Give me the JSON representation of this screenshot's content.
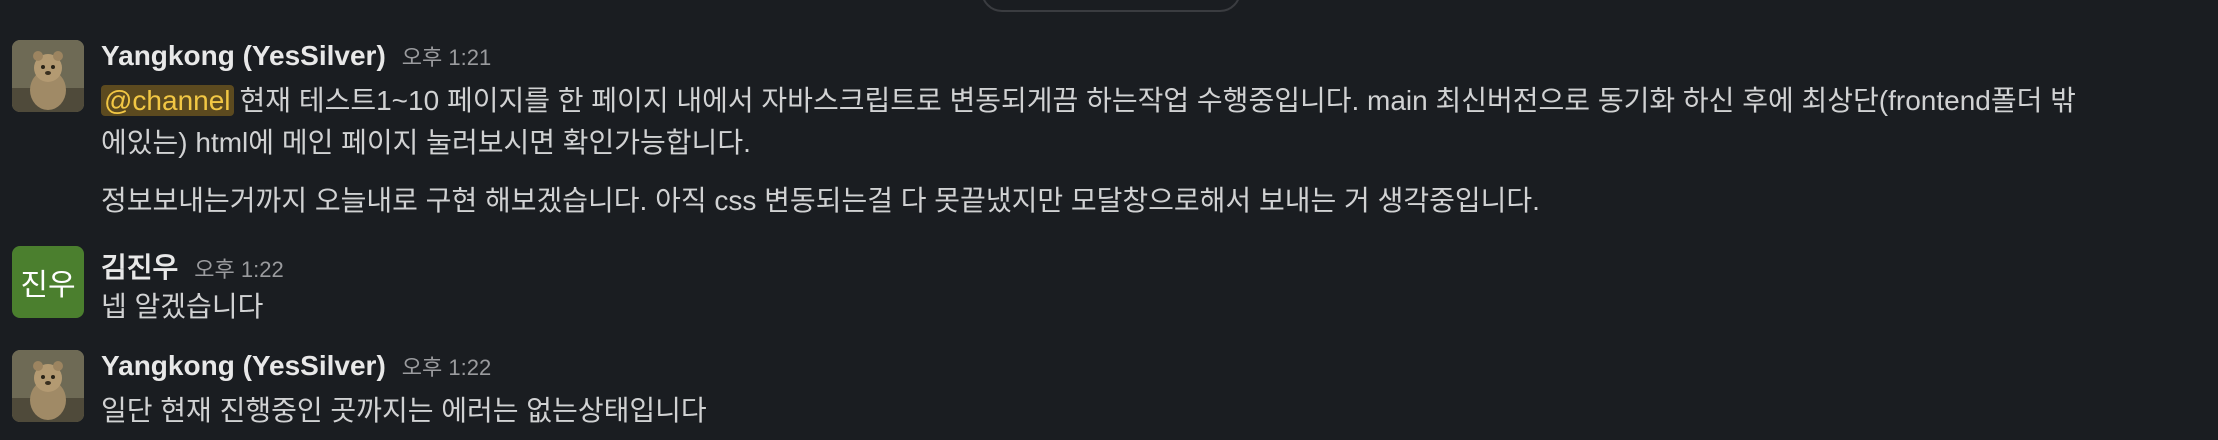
{
  "messages": [
    {
      "sender": "Yangkong (YesSilver)",
      "time": "오후 1:21",
      "mention": "@channel",
      "line1_rest": "현재 테스트1~10 페이지를 한 페이지 내에서 자바스크립트로 변동되게끔 하는작업 수행중입니다. main 최신버전으로 동기화 하신 후에 최상단(frontend폴더 밖",
      "line2": "에있는) html에 메인 페이지 눌러보시면 확인가능합니다.",
      "paragraph2": "정보보내는거까지 오늘내로 구현 해보겠습니다. 아직 css 변동되는걸 다 못끝냈지만 모달창으로해서 보내는 거 생각중입니다."
    },
    {
      "sender": "김진우",
      "time": "오후 1:22",
      "avatar_initials": "진우",
      "text": "넵 알겠습니다"
    },
    {
      "sender": "Yangkong (YesSilver)",
      "time": "오후 1:22",
      "text": "일단 현재 진행중인 곳까지는 에러는 없는상태입니다"
    }
  ],
  "colors": {
    "background": "#1a1d21",
    "mention_bg": "#5c4a1f",
    "mention_text": "#f2c744",
    "initials_avatar": "#4b7f2e"
  }
}
